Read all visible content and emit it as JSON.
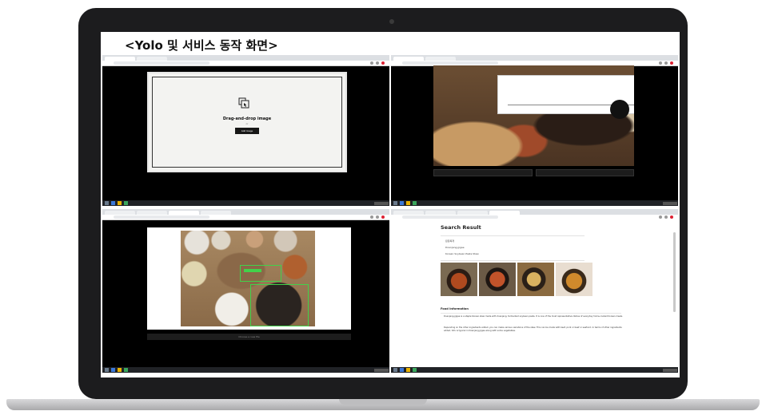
{
  "slide": {
    "title": "<Yolo 및 서비스 동작 화면>"
  },
  "upload_screen": {
    "heading": "Drag-and-drop image",
    "subtext": "or",
    "button_label": "Add Image"
  },
  "detection_screen": {
    "button_label": "Choose a new file"
  },
  "search_result": {
    "title": "Search Result",
    "names": [
      "된장찌개",
      "Doenjang-jjigae",
      "Korean Soybean Paste Stew"
    ],
    "food_info_title": "Food Information",
    "food_info_items": [
      "Doenjang-jjigae is a staple Korean stew made with doenjang, fermented soybean paste. It is one of the most representative dishes of everyday home-cooked Korean meals.",
      "Depending on the other ingredients added, you can make various variations of the stew. This can be made with beef, pork or beef or seafood. In terms of other ingredients added, tofu is typical in Doenjang-jjigae along with some vegetables."
    ]
  },
  "colors": {
    "laptop_bezel": "#1c1c1e",
    "detection_box": "#42d14a",
    "app_background": "#000000"
  }
}
